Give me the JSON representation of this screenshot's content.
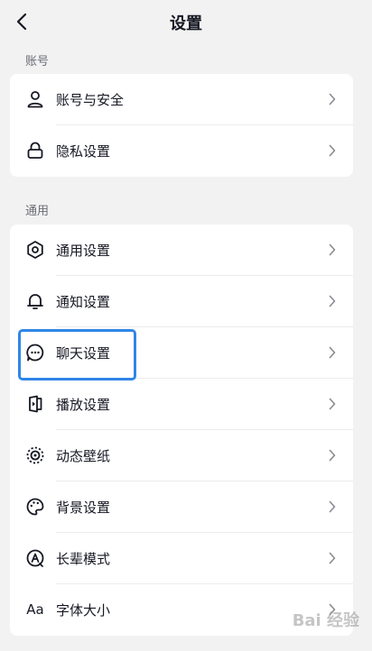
{
  "header": {
    "title": "设置",
    "back_icon": "chevron-left-icon"
  },
  "sections": [
    {
      "title": "账号",
      "items": [
        {
          "label": "账号与安全",
          "icon": "user-icon"
        },
        {
          "label": "隐私设置",
          "icon": "lock-icon"
        }
      ]
    },
    {
      "title": "通用",
      "items": [
        {
          "label": "通用设置",
          "icon": "gear-icon"
        },
        {
          "label": "通知设置",
          "icon": "bell-icon"
        },
        {
          "label": "聊天设置",
          "icon": "chat-bubble-icon",
          "highlighted": true
        },
        {
          "label": "播放设置",
          "icon": "play-icon"
        },
        {
          "label": "动态壁纸",
          "icon": "dynamic-wallpaper-icon"
        },
        {
          "label": "背景设置",
          "icon": "palette-icon"
        },
        {
          "label": "长辈模式",
          "icon": "elder-mode-icon"
        },
        {
          "label": "字体大小",
          "icon": "font-size-icon",
          "icon_text": "Aa"
        }
      ]
    }
  ],
  "colors": {
    "highlight": "#2f86e8",
    "background": "#f2f2f3",
    "card": "#ffffff"
  },
  "watermark": "Bai 经验"
}
